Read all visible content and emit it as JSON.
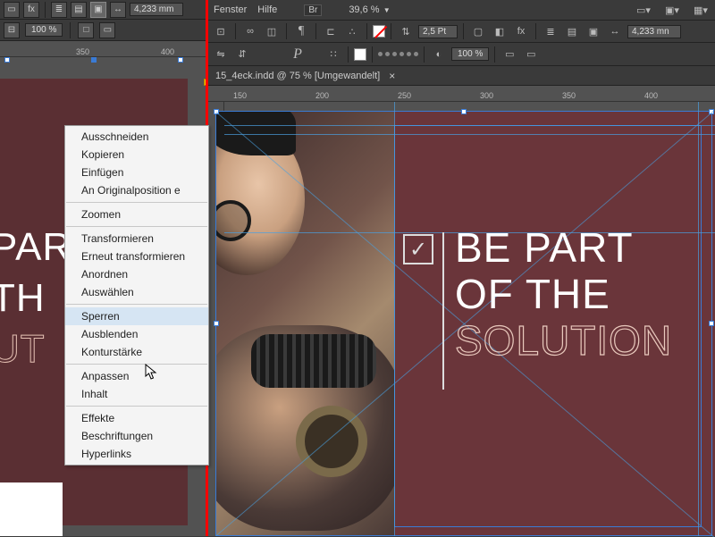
{
  "left": {
    "zoom": "100 %",
    "measurement": "4,233 mm",
    "ruler": {
      "t1": "350",
      "t2": "400"
    },
    "text": {
      "l1": "PAR",
      "l2": "TH",
      "l3": "UT"
    }
  },
  "right": {
    "menubar": {
      "fenster": "Fenster",
      "hilfe": "Hilfe",
      "br": "Br",
      "zoom": "39,6 %"
    },
    "toolbar": {
      "stroke": "2,5 Pt",
      "zoom": "100 %",
      "measurement": "4,233 mn"
    },
    "doc_tab": {
      "title": "15_4eck.indd @ 75 % [Umgewandelt]",
      "close": "×"
    },
    "ruler": {
      "t150": "150",
      "t200": "200",
      "t250": "250",
      "t300": "300",
      "t350": "350",
      "t400": "400"
    },
    "headline": {
      "l1": "BE PART",
      "l2": "OF THE",
      "l3": "SOLUTION"
    },
    "checkmark": "✓"
  },
  "context_menu": {
    "items": [
      "Ausschneiden",
      "Kopieren",
      "Einfügen",
      "An Originalposition e",
      "Zoomen",
      "Transformieren",
      "Erneut transformieren",
      "Anordnen",
      "Auswählen",
      "Sperren",
      "Ausblenden",
      "Konturstärke",
      "Anpassen",
      "Inhalt",
      "Effekte",
      "Beschriftungen",
      "Hyperlinks"
    ],
    "hover_index": 9,
    "separators_after": [
      3,
      4,
      8,
      11,
      13
    ]
  }
}
